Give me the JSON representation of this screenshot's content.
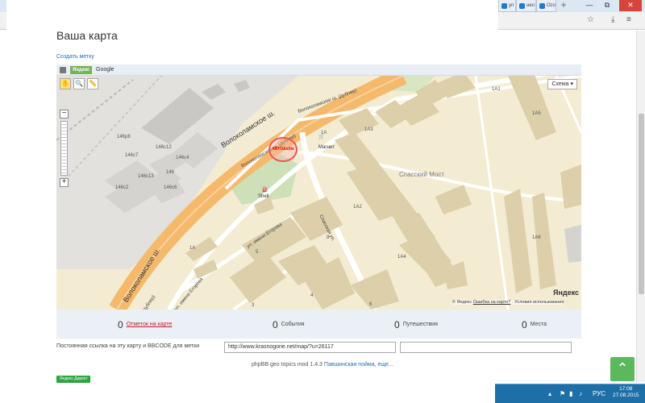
{
  "browser": {
    "tabs": [
      "уп",
      "нео",
      "Ozo"
    ],
    "new_tab": "+",
    "window_minimize": "—",
    "window_restore": "⧉",
    "window_close": "✕"
  },
  "page": {
    "title": "Ваша карта",
    "create_marker_link": "Создать метку"
  },
  "map": {
    "provider_yandex": "Яндекс",
    "provider_google": "Google",
    "scheme_button": "Схема ▾",
    "zoom_in": "+",
    "zoom_out": "−",
    "roads": {
      "volokolamskoe_upper": "Волоколамское ш.",
      "volokolamskoe_lower": "Волоколамское ш.",
      "dubler1": "Волоколамское ш. (дублер)",
      "dubler2": "Волоколамское ш. (дублер)",
      "spasskaya": "Спасская ул.",
      "egorova1": "ул. имени Егорова",
      "egorova2": "ул. имени Егорова",
      "dubler_short": "(дублер)"
    },
    "district": "Спасский Мост",
    "pois": {
      "magnit": "Магнит",
      "shell": "Shell"
    },
    "marker_label": "АВТО&stile",
    "building_labels": [
      "146р8",
      "146с12",
      "146с7",
      "146с4",
      "146",
      "146с13",
      "146с6",
      "146с2",
      "1А1",
      "1А3",
      "1А2",
      "1А",
      "1А4",
      "1А5",
      "1А6",
      "1А",
      "5",
      "6",
      "3",
      "4",
      "8"
    ],
    "yandex_logo": "Яндекс",
    "copyright": "© Яндекс",
    "copyright_error_link": "Ошибка на карте?",
    "copyright_terms": "· Условия использования"
  },
  "stats": [
    {
      "count": "0",
      "label": "Отметок на карте"
    },
    {
      "count": "0",
      "label": "События"
    },
    {
      "count": "0",
      "label": "Путешествия"
    },
    {
      "count": "0",
      "label": "Места"
    }
  ],
  "permalink": {
    "label": "Постоянная ссылка на эту карту и BBCODE для метки",
    "url": "http://www.krasnogorie.net/map/?u=26117",
    "bbcode": ""
  },
  "footer": {
    "credit": "phpBB geo topics mod 1.4.3 ",
    "credit_link": "Павшинская пойма, еще...",
    "yandex_direct": "Яндекс.Директ",
    "scroll_up": "⌃"
  },
  "taskbar": {
    "lang": "РУС",
    "time": "17:08",
    "date": "27.08.2015"
  }
}
